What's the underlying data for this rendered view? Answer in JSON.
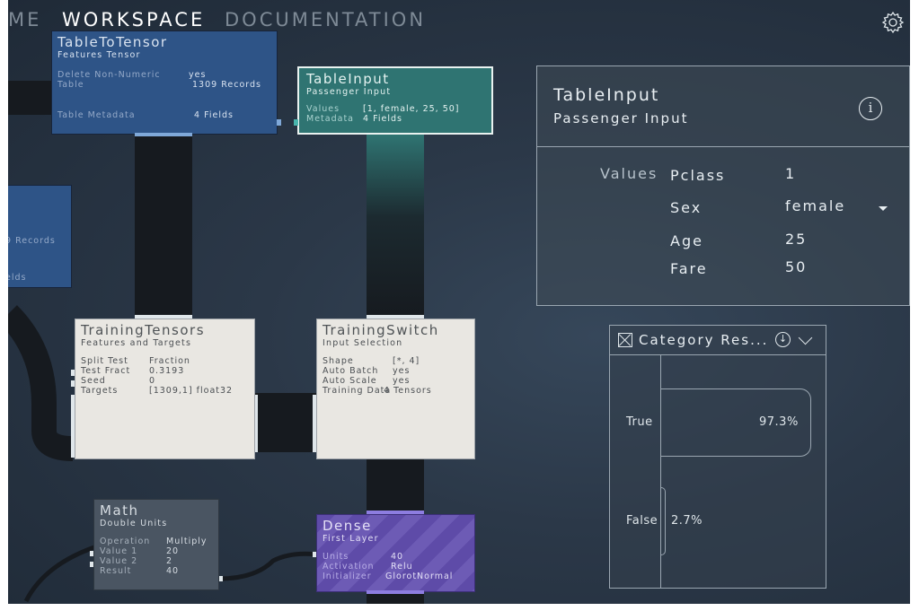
{
  "nav": {
    "tabs": [
      "ME",
      "WORKSPACE",
      "DOCUMENTATION"
    ],
    "active": "WORKSPACE"
  },
  "nodes": {
    "table_to_tensor": {
      "title": "TableToTensor",
      "subtitle": "Features Tensor",
      "rows": [
        {
          "k": "Delete Non-Numeric",
          "v": "yes"
        },
        {
          "k": "Table",
          "v": "1309 Records"
        },
        {
          "k": "Table Metadata",
          "v": "4 Fields"
        }
      ]
    },
    "table_input": {
      "title": "TableInput",
      "subtitle": "Passenger Input",
      "rows": [
        {
          "k": "Values",
          "v": "[1, female, 25, 50]"
        },
        {
          "k": "Metadata",
          "v": "4 Fields"
        }
      ]
    },
    "offscreen": {
      "rows": [
        {
          "v": "9 Records"
        },
        {
          "v": "elds"
        }
      ]
    },
    "training_tensors": {
      "title": "TrainingTensors",
      "subtitle": "Features and Targets",
      "rows": [
        {
          "k": "Split Test",
          "v": "Fraction"
        },
        {
          "k": "Test Fract",
          "v": "0.3193"
        },
        {
          "k": "Seed",
          "v": "0"
        },
        {
          "k": "Targets",
          "v": "[1309,1] float32"
        }
      ]
    },
    "training_switch": {
      "title": "TrainingSwitch",
      "subtitle": "Input Selection",
      "rows": [
        {
          "k": "Shape",
          "v": "[*, 4]"
        },
        {
          "k": "Auto Batch",
          "v": "yes"
        },
        {
          "k": "Auto Scale",
          "v": "yes"
        },
        {
          "k": "Training Data",
          "v": "4 Tensors"
        }
      ]
    },
    "math": {
      "title": "Math",
      "subtitle": "Double Units",
      "rows": [
        {
          "k": "Operation",
          "v": "Multiply"
        },
        {
          "k": "Value 1",
          "v": "20"
        },
        {
          "k": "Value 2",
          "v": "2"
        },
        {
          "k": "Result",
          "v": "40"
        }
      ]
    },
    "dense": {
      "title": "Dense",
      "subtitle": "First Layer",
      "rows": [
        {
          "k": "Units",
          "v": "40"
        },
        {
          "k": "Activation",
          "v": "Relu"
        },
        {
          "k": "Initializer",
          "v": "GlorotNormal"
        }
      ]
    }
  },
  "inspector": {
    "title": "TableInput",
    "subtitle": "Passenger Input",
    "section_label": "Values",
    "fields": [
      {
        "key": "Pclass",
        "value": "1"
      },
      {
        "key": "Sex",
        "value": "female"
      },
      {
        "key": "Age",
        "value": "25"
      },
      {
        "key": "Fare",
        "value": "50"
      }
    ]
  },
  "category_results": {
    "title": "Category Res...",
    "categories": [
      {
        "label": "True",
        "value": 97.3,
        "text": "97.3%"
      },
      {
        "label": "False",
        "value": 2.7,
        "text": "2.7%"
      }
    ]
  },
  "colors": {
    "accent_teal": "#2f7472",
    "node_blue": "#2e5487",
    "node_purple": "#5e4ba8"
  }
}
